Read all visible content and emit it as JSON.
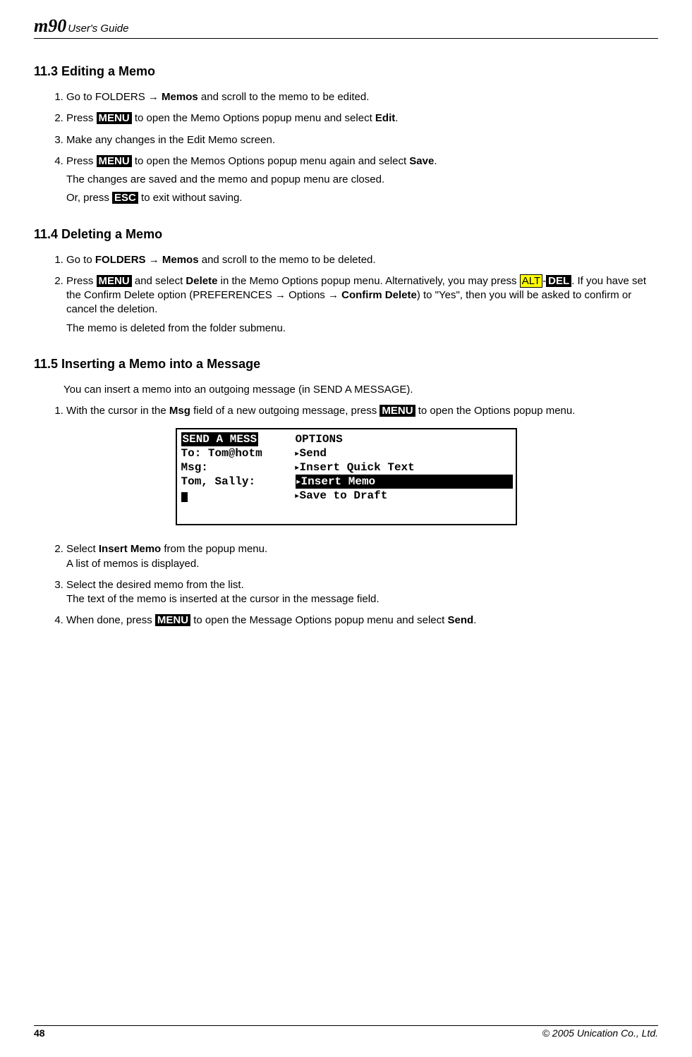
{
  "header": {
    "logo": "m90",
    "guide": "User's Guide"
  },
  "s113": {
    "title": "11.3  Editing a Memo",
    "step1_a": "Go to FOLDERS → ",
    "step1_b": "Memos",
    "step1_c": " and scroll to the memo to be edited.",
    "step2_a": "Press ",
    "step2_key": "MENU",
    "step2_b": " to open the Memo Options popup menu and select ",
    "step2_c": "Edit",
    "step2_d": ".",
    "step3": "Make any changes in the Edit Memo screen.",
    "step4_a": "Press ",
    "step4_key": "MENU",
    "step4_b": " to open the Memos Options popup menu again and select ",
    "step4_c": "Save",
    "step4_d": ".",
    "step4_e": "The changes are saved and the memo and popup menu are closed.",
    "step4_f": "Or, press ",
    "step4_esc": "ESC",
    "step4_g": " to exit without saving."
  },
  "s114": {
    "title": "11.4  Deleting a Memo",
    "step1_a": "Go to ",
    "step1_b": "FOLDERS",
    "step1_c": " → ",
    "step1_d": "Memos",
    "step1_e": " and scroll to the memo to be deleted.",
    "step2_a": "Press ",
    "step2_menu": "MENU",
    "step2_b": " and select ",
    "step2_c": "Delete",
    "step2_d": " in the Memo Options popup menu. Alternatively, you may press ",
    "step2_alt": "ALT",
    "step2_dash": "-",
    "step2_del": "DEL",
    "step2_e": ". If you have set the Confirm Delete option (PREFERENCES → Options → ",
    "step2_f": "Confirm Delete",
    "step2_g": ") to \"Yes\", then you will be asked to confirm or cancel the deletion.",
    "step2_h": "The memo is deleted from the folder submenu."
  },
  "s115": {
    "title": "11.5  Inserting a Memo into a Message",
    "intro": "You can insert a memo into an outgoing message (in SEND A MESSAGE).",
    "step1_a": "With the cursor in the ",
    "step1_b": "Msg",
    "step1_c": " field of a new outgoing message, press ",
    "step1_menu": "MENU",
    "step1_d": " to open the Options popup menu.",
    "step2_a": "Select ",
    "step2_b": "Insert Memo",
    "step2_c": " from the popup menu.",
    "step2_d": "A list of memos is displayed.",
    "step3_a": "Select the desired memo from the list.",
    "step3_b": "The text of the memo is inserted at the cursor in the message field.",
    "step4_a": "When done, press ",
    "step4_menu": "MENU",
    "step4_b": " to open the Message Options popup menu and select ",
    "step4_c": "Send",
    "step4_d": "."
  },
  "screen": {
    "left_title": " SEND A MESS",
    "to": "To: Tom@hotm",
    "msg": "Msg:",
    "body": "Tom, Sally:",
    "right_title": " OPTIONS",
    "opt1": "Send",
    "opt2": "Insert Quick Text",
    "opt3": "Insert Memo",
    "opt4": "Save to Draft"
  },
  "footer": {
    "page": "48",
    "copyright": "© 2005 Unication Co., Ltd."
  }
}
